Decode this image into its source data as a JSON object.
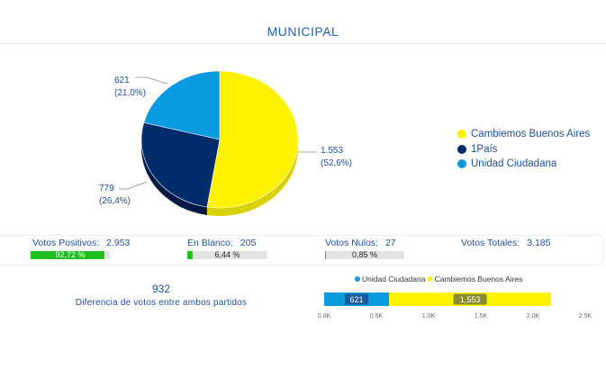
{
  "title": "MUNICIPAL",
  "colors": {
    "cambiemos": "#fff200",
    "unopais": "#002c6b",
    "unidad": "#0a9ae0",
    "green": "#1fbf1f"
  },
  "pie": {
    "labels": {
      "cambiemos_value": "1.553",
      "cambiemos_pct": "(52,6%)",
      "unopais_value": "779",
      "unopais_pct": "(26,4%)",
      "unidad_value": "621",
      "unidad_pct": "(21,0%)"
    },
    "legend": [
      "Cambiemos Buenos Aires",
      "1País",
      "Unidad Ciudadana"
    ]
  },
  "stats": {
    "positivos_label": "Votos Positivos:",
    "positivos_value": "2.953",
    "positivos_bar": "92,72 %",
    "positivos_frac": 0.9272,
    "blanco_label": "En Blanco:",
    "blanco_value": "205",
    "blanco_bar": "6,44 %",
    "blanco_frac": 0.0644,
    "nulos_label": "Votos Nulos:",
    "nulos_value": "27",
    "nulos_bar": "0,85 %",
    "nulos_frac": 0.0085,
    "totales_label": "Votos Totales:",
    "totales_value": "3.185"
  },
  "diff": {
    "value": "932",
    "label": "Diferencia de votos entre ambos partidos"
  },
  "chart_data": [
    {
      "type": "pie",
      "categories": [
        "Cambiemos Buenos Aires",
        "1País",
        "Unidad Ciudadana"
      ],
      "values": [
        1553,
        779,
        621
      ],
      "percentages": [
        52.6,
        26.4,
        21.0
      ],
      "legend": "right"
    },
    {
      "type": "bar",
      "orientation": "horizontal",
      "stacked": true,
      "series": [
        {
          "name": "Unidad Ciudadana",
          "values": [
            621
          ],
          "label": "621"
        },
        {
          "name": "Cambiemos Buenos Aires",
          "values": [
            1553
          ],
          "label": "1,553"
        }
      ],
      "xlim": [
        0,
        2500
      ],
      "x_ticks": [
        "0.0K",
        "0.5K",
        "1.0K",
        "1.5K",
        "2.0K",
        "2.5K"
      ],
      "legend": "top"
    }
  ]
}
